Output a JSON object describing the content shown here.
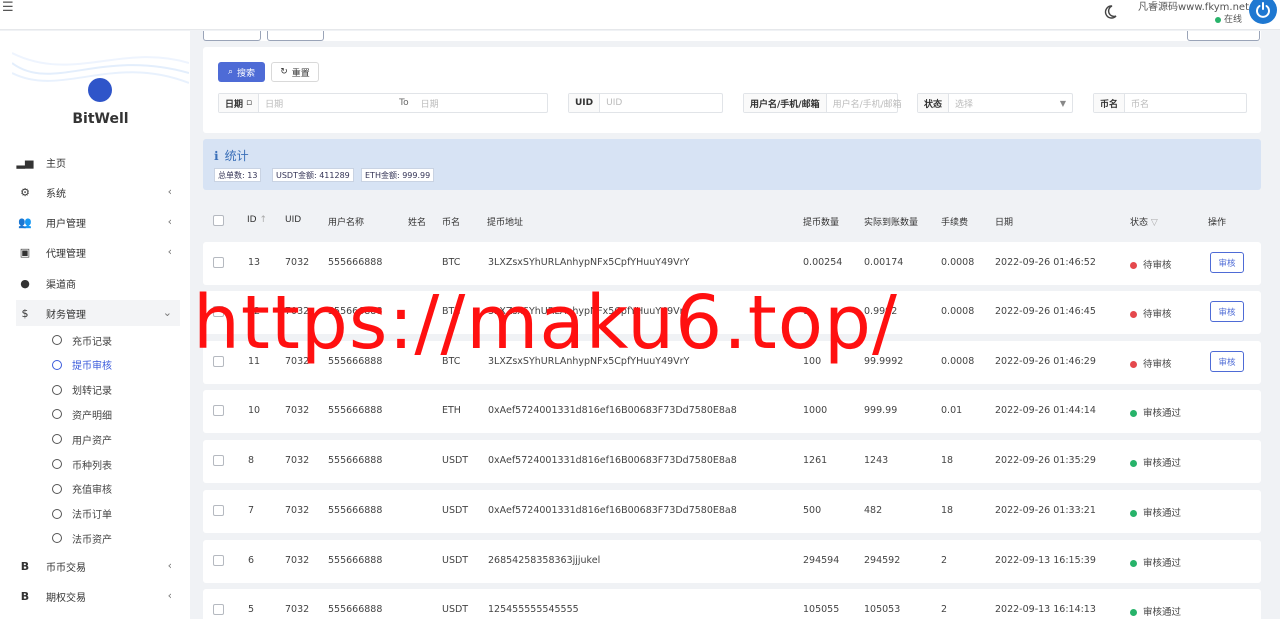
{
  "topbar": {
    "site_name": "凡睿源码www.fkym.net",
    "status": "在线",
    "status_color": "#27b36a",
    "icons": [
      "menu-icon",
      "moon-icon",
      "power-icon"
    ]
  },
  "sidebar": {
    "logo_text": "BitWell",
    "items": [
      {
        "label": "主页",
        "icon": "chart-icon"
      },
      {
        "label": "系统",
        "icon": "gear-icon"
      },
      {
        "label": "用户管理",
        "icon": "users-icon"
      },
      {
        "label": "代理管理",
        "icon": "id-card-icon"
      },
      {
        "label": "渠道商",
        "icon": "user-icon"
      },
      {
        "label": "财务管理",
        "icon": "dollar-icon"
      }
    ],
    "sub_items": [
      {
        "label": "充币记录"
      },
      {
        "label": "提币审核"
      },
      {
        "label": "划转记录"
      },
      {
        "label": "资产明细"
      },
      {
        "label": "用户资产"
      },
      {
        "label": "币种列表"
      },
      {
        "label": "充值审核"
      },
      {
        "label": "法币订单"
      },
      {
        "label": "法币资产"
      }
    ],
    "bottom_items": [
      {
        "label": "币币交易",
        "icon": "bitcoin-icon"
      },
      {
        "label": "期权交易",
        "icon": "bitcoin-icon"
      }
    ]
  },
  "filter": {
    "search_label": "搜索",
    "reset_label": "重置",
    "date_label": "日期",
    "date_from_placeholder": "日期",
    "to_label": "To",
    "date_to_placeholder": "日期",
    "uid_label": "UID",
    "uid_placeholder": "UID",
    "user_label": "用户名/手机/邮箱",
    "user_placeholder": "用户名/手机/邮箱",
    "status_label": "状态",
    "status_placeholder": "选择",
    "coin_label": "币名",
    "coin_placeholder": "币名"
  },
  "stats": {
    "title": "统计",
    "total_orders": "总单数: 13",
    "usdt_amount": "USDT金额: 411289",
    "eth_amount": "ETH金额: 999.99"
  },
  "table": {
    "headers": [
      "ID",
      "UID",
      "用户名称",
      "姓名",
      "币名",
      "提币地址",
      "提币数量",
      "实际到账数量",
      "手续费",
      "日期",
      "状态",
      "操作"
    ],
    "audit_label": "审核",
    "pending_color": "#e5484d",
    "approved_color": "#27b36a",
    "rows": [
      {
        "id": "13",
        "uid": "7032",
        "username": "555666888",
        "name": "",
        "coin": "BTC",
        "address": "3LXZsxSYhURLAnhypNFx5CpfYHuuY49VrY",
        "amount": "0.00254",
        "received": "0.00174",
        "fee": "0.0008",
        "date": "2022-09-26 01:46:52",
        "status": "待审核",
        "pending": true
      },
      {
        "id": "12",
        "uid": "7032",
        "username": "555666888",
        "name": "",
        "coin": "BTC",
        "address": "3LXZsxSYhURLAnhypNFx5CpfYHuuY49VrY",
        "amount": "1",
        "received": "0.9992",
        "fee": "0.0008",
        "date": "2022-09-26 01:46:45",
        "status": "待审核",
        "pending": true
      },
      {
        "id": "11",
        "uid": "7032",
        "username": "555666888",
        "name": "",
        "coin": "BTC",
        "address": "3LXZsxSYhURLAnhypNFx5CpfYHuuY49VrY",
        "amount": "100",
        "received": "99.9992",
        "fee": "0.0008",
        "date": "2022-09-26 01:46:29",
        "status": "待审核",
        "pending": true
      },
      {
        "id": "10",
        "uid": "7032",
        "username": "555666888",
        "name": "",
        "coin": "ETH",
        "address": "0xAef5724001331d816ef16B00683F73Dd7580E8a8",
        "amount": "1000",
        "received": "999.99",
        "fee": "0.01",
        "date": "2022-09-26 01:44:14",
        "status": "审核通过",
        "pending": false
      },
      {
        "id": "8",
        "uid": "7032",
        "username": "555666888",
        "name": "",
        "coin": "USDT",
        "address": "0xAef5724001331d816ef16B00683F73Dd7580E8a8",
        "amount": "1261",
        "received": "1243",
        "fee": "18",
        "date": "2022-09-26 01:35:29",
        "status": "审核通过",
        "pending": false
      },
      {
        "id": "7",
        "uid": "7032",
        "username": "555666888",
        "name": "",
        "coin": "USDT",
        "address": "0xAef5724001331d816ef16B00683F73Dd7580E8a8",
        "amount": "500",
        "received": "482",
        "fee": "18",
        "date": "2022-09-26 01:33:21",
        "status": "审核通过",
        "pending": false
      },
      {
        "id": "6",
        "uid": "7032",
        "username": "555666888",
        "name": "",
        "coin": "USDT",
        "address": "26854258358363jjjukel",
        "amount": "294594",
        "received": "294592",
        "fee": "2",
        "date": "2022-09-13 16:15:39",
        "status": "审核通过",
        "pending": false
      },
      {
        "id": "5",
        "uid": "7032",
        "username": "555666888",
        "name": "",
        "coin": "USDT",
        "address": "125455555545555",
        "amount": "105055",
        "received": "105053",
        "fee": "2",
        "date": "2022-09-13 16:14:13",
        "status": "审核通过",
        "pending": false
      }
    ]
  },
  "watermark": "https://maku6.top/"
}
